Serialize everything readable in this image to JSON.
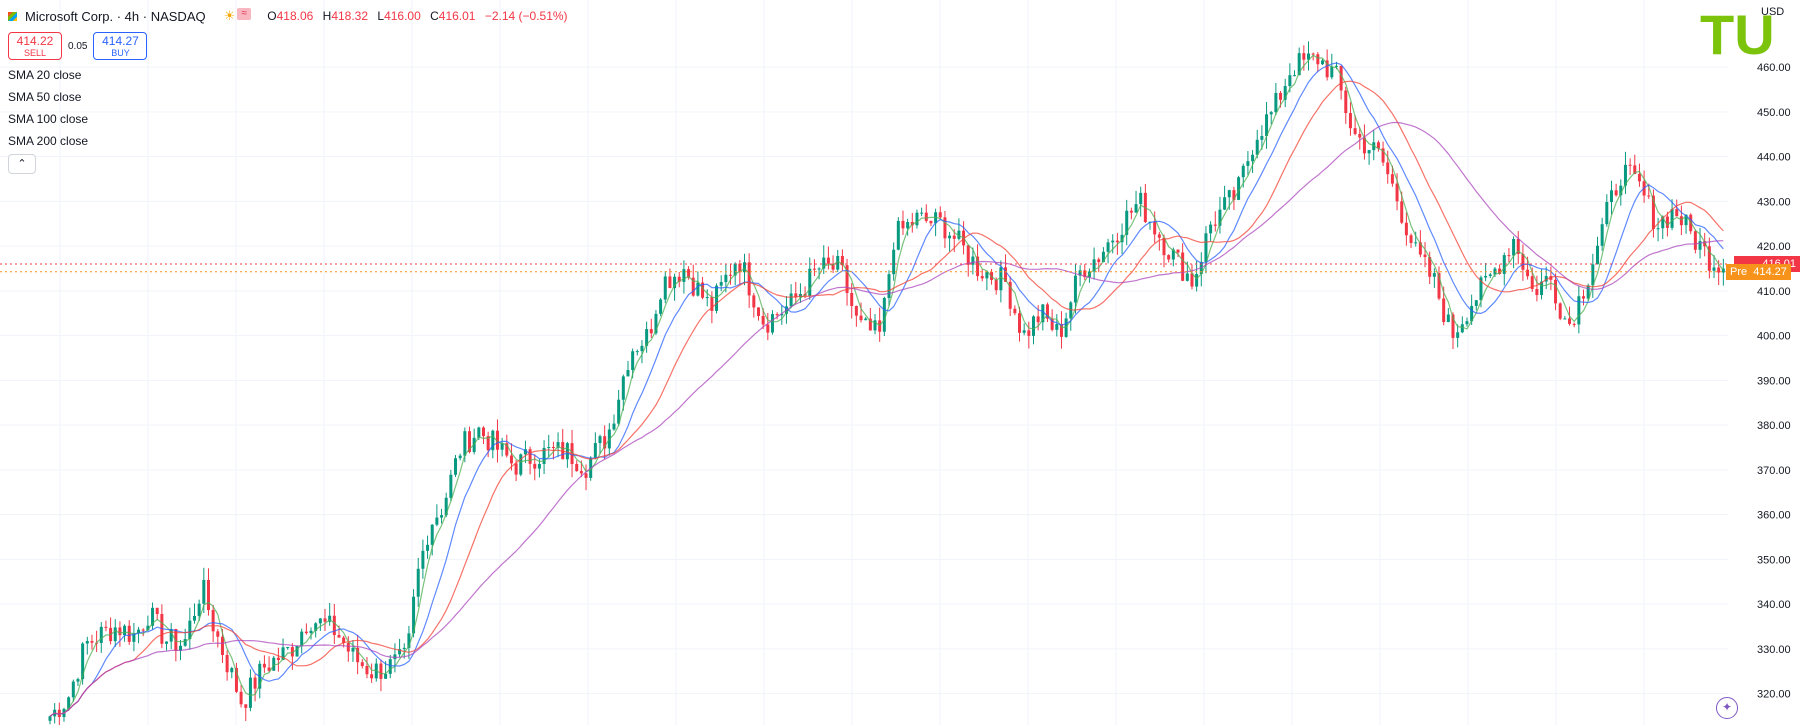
{
  "header": {
    "symbol_title": "Microsoft Corp. · 4h · NASDAQ",
    "ohlc": [
      {
        "key": "O",
        "value": "418.06"
      },
      {
        "key": "H",
        "value": "418.32"
      },
      {
        "key": "L",
        "value": "416.00"
      },
      {
        "key": "C",
        "value": "416.01"
      }
    ],
    "change": "−2.14 (−0.51%)",
    "sell_price": "414.22",
    "sell_label": "SELL",
    "spread": "0.05",
    "buy_price": "414.27",
    "buy_label": "BUY",
    "indicators": [
      "SMA 20 close",
      "SMA 50 close",
      "SMA 100 close",
      "SMA 200 close"
    ],
    "collapse_symbol": "⌃"
  },
  "axis": {
    "currency_label": "USD"
  },
  "price_tags": {
    "last": "416.01",
    "pre_label": "Pre",
    "pre": "414.27"
  },
  "logo_text": "TU",
  "colors": {
    "up": "#089981",
    "down": "#f23645",
    "sma20": "#4caf50",
    "sma50": "#2962ff",
    "sma100": "#f44336",
    "sma200": "#ab47bc",
    "pre": "#f7931a"
  },
  "chart_data": {
    "type": "candlestick",
    "title": "Microsoft Corp. · 4h · NASDAQ",
    "ylim": [
      313,
      475
    ],
    "y_ticks": [
      320,
      330,
      340,
      350,
      360,
      370,
      380,
      390,
      400,
      410,
      420,
      430,
      440,
      450,
      460
    ],
    "grid": true,
    "last_price": 416.01,
    "pre_market_price": 414.27,
    "candle_count": 360,
    "close_anchors": [
      [
        0,
        315
      ],
      [
        20,
        319
      ],
      [
        40,
        331
      ],
      [
        55,
        333
      ],
      [
        75,
        335
      ],
      [
        95,
        333
      ],
      [
        110,
        338
      ],
      [
        130,
        332
      ],
      [
        150,
        331
      ],
      [
        170,
        344
      ],
      [
        185,
        334
      ],
      [
        215,
        318
      ],
      [
        240,
        326
      ],
      [
        270,
        330
      ],
      [
        290,
        337
      ],
      [
        320,
        334
      ],
      [
        340,
        328
      ],
      [
        360,
        325
      ],
      [
        380,
        326
      ],
      [
        400,
        328
      ],
      [
        410,
        345
      ],
      [
        425,
        358
      ],
      [
        440,
        362
      ],
      [
        460,
        375
      ],
      [
        480,
        379
      ],
      [
        500,
        375
      ],
      [
        520,
        371
      ],
      [
        540,
        373
      ],
      [
        560,
        374
      ],
      [
        580,
        374
      ],
      [
        600,
        371
      ],
      [
        625,
        378
      ],
      [
        650,
        397
      ],
      [
        670,
        400
      ],
      [
        685,
        412
      ],
      [
        710,
        415
      ],
      [
        740,
        406
      ],
      [
        770,
        418
      ],
      [
        800,
        403
      ],
      [
        830,
        407
      ],
      [
        860,
        415
      ],
      [
        885,
        415
      ],
      [
        905,
        402
      ],
      [
        930,
        400
      ],
      [
        945,
        422
      ],
      [
        970,
        426
      ],
      [
        1000,
        425
      ],
      [
        1020,
        420
      ],
      [
        1040,
        415
      ],
      [
        1070,
        412
      ],
      [
        1090,
        400
      ],
      [
        1110,
        405
      ],
      [
        1130,
        400
      ],
      [
        1155,
        415
      ],
      [
        1175,
        418
      ],
      [
        1200,
        425
      ],
      [
        1220,
        430
      ],
      [
        1250,
        420
      ],
      [
        1280,
        412
      ],
      [
        1300,
        425
      ],
      [
        1330,
        432
      ],
      [
        1350,
        445
      ],
      [
        1370,
        450
      ],
      [
        1390,
        460
      ],
      [
        1420,
        462
      ],
      [
        1440,
        458
      ],
      [
        1460,
        445
      ],
      [
        1490,
        440
      ],
      [
        1510,
        430
      ],
      [
        1530,
        418
      ],
      [
        1550,
        412
      ],
      [
        1570,
        400
      ],
      [
        1590,
        407
      ],
      [
        1610,
        412
      ],
      [
        1640,
        422
      ],
      [
        1660,
        410
      ],
      [
        1680,
        413
      ],
      [
        1700,
        402
      ],
      [
        1720,
        412
      ],
      [
        1740,
        425
      ],
      [
        1760,
        437
      ],
      [
        1780,
        433
      ],
      [
        1800,
        425
      ],
      [
        1820,
        428
      ],
      [
        1840,
        422
      ],
      [
        1860,
        417
      ],
      [
        1874,
        416.01
      ]
    ],
    "sma_series": [
      {
        "name": "SMA 20 close",
        "window": 20
      },
      {
        "name": "SMA 50 close",
        "window": 50
      },
      {
        "name": "SMA 100 close",
        "window": 100
      },
      {
        "name": "SMA 200 close",
        "window": 200
      }
    ]
  }
}
